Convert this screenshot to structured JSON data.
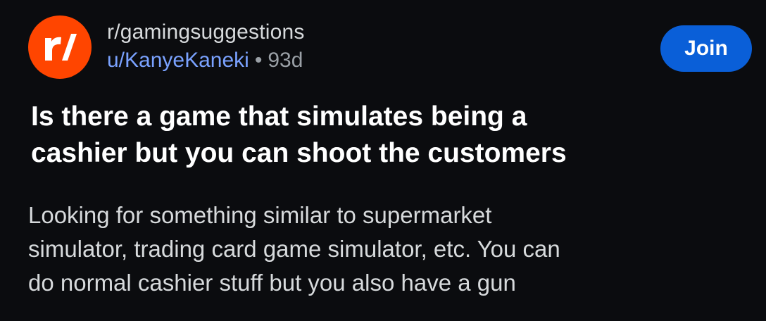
{
  "post": {
    "subreddit": "r/gamingsuggestions",
    "username": "u/KanyeKaneki",
    "separator": "•",
    "age": "93d",
    "join_label": "Join",
    "avatar_icon": "reddit-r-logo-icon",
    "title_line1": "Is there a game that simulates being a",
    "title_line2": "cashier but you can shoot the customers",
    "body_line1": "Looking for something similar to supermarket",
    "body_line2": "simulator, trading card game simulator, etc. You can",
    "body_line3": "do normal cashier stuff but you also have a gun"
  },
  "colors": {
    "background": "#0b0c0f",
    "avatar": "#ff4500",
    "join_button": "#0a5fd8",
    "username": "#7aa2ff"
  }
}
